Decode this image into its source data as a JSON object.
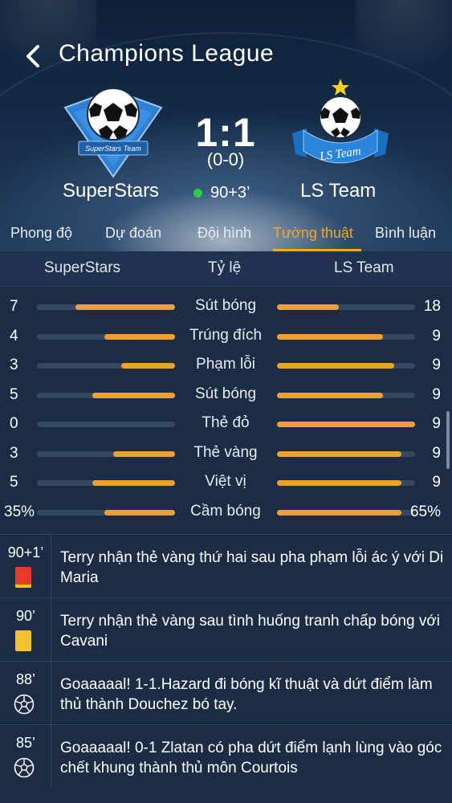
{
  "header": {
    "title": "Champions League",
    "back_icon": "chevron-left-icon"
  },
  "match": {
    "home_team": "SuperStars",
    "home_logo_text": "SuperStars Team",
    "away_team": "LS Team",
    "away_logo_text": "LS Team",
    "score": "1:1",
    "halftime": "(0-0)",
    "time": "90+3’",
    "live_color": "#2ecc40"
  },
  "tabs": [
    {
      "label": "Phong độ"
    },
    {
      "label": "Dự đoán"
    },
    {
      "label": "Đội hình"
    },
    {
      "label": "Tường thuật",
      "active": true
    },
    {
      "label": "Bình luận"
    }
  ],
  "stats_header": {
    "home": "SuperStars",
    "middle": "Tỷ lệ",
    "away": "LS Team"
  },
  "stats": [
    {
      "label": "Sút bóng",
      "home": "7",
      "away": "18",
      "home_ratio": 0.72,
      "away_ratio": 0.45
    },
    {
      "label": "Trúng đích",
      "home": "4",
      "away": "9",
      "home_ratio": 0.51,
      "away_ratio": 0.77
    },
    {
      "label": "Phạm lỗi",
      "home": "3",
      "away": "9",
      "home_ratio": 0.39,
      "away_ratio": 0.85
    },
    {
      "label": "Sút bóng",
      "home": "5",
      "away": "9",
      "home_ratio": 0.6,
      "away_ratio": 0.77
    },
    {
      "label": "Thẻ đỏ",
      "home": "0",
      "away": "9",
      "home_ratio": 0.0,
      "away_ratio": 1.0
    },
    {
      "label": "Thẻ vàng",
      "home": "3",
      "away": "9",
      "home_ratio": 0.45,
      "away_ratio": 0.9
    },
    {
      "label": "Việt vị",
      "home": "5",
      "away": "9",
      "home_ratio": 0.6,
      "away_ratio": 0.9
    },
    {
      "label": "Cầm bóng",
      "home": "35%",
      "away": "65%",
      "home_ratio": 0.51,
      "away_ratio": 0.9
    }
  ],
  "accent_color": "#f5a623",
  "events": [
    {
      "minute": "90+1’",
      "icon": "red-card-icon",
      "text": "Terry nhận thẻ vàng thứ hai sau pha phạm lỗi ác ý với Di Maria"
    },
    {
      "minute": "90’",
      "icon": "yellow-card-icon",
      "text": "Terry nhận thẻ vàng sau tình huống tranh chấp bóng với Cavani"
    },
    {
      "minute": "88’",
      "icon": "soccer-ball-icon",
      "text": "Goaaaaal! 1-1.Hazard đi bóng kĩ thuật và dứt điểm làm thủ thành Douchez bó tay."
    },
    {
      "minute": "85’",
      "icon": "soccer-ball-icon",
      "text": "Goaaaaal! 0-1 Zlatan có pha dứt điểm lạnh lùng vào góc chết khung thành thủ môn Courtois"
    }
  ]
}
